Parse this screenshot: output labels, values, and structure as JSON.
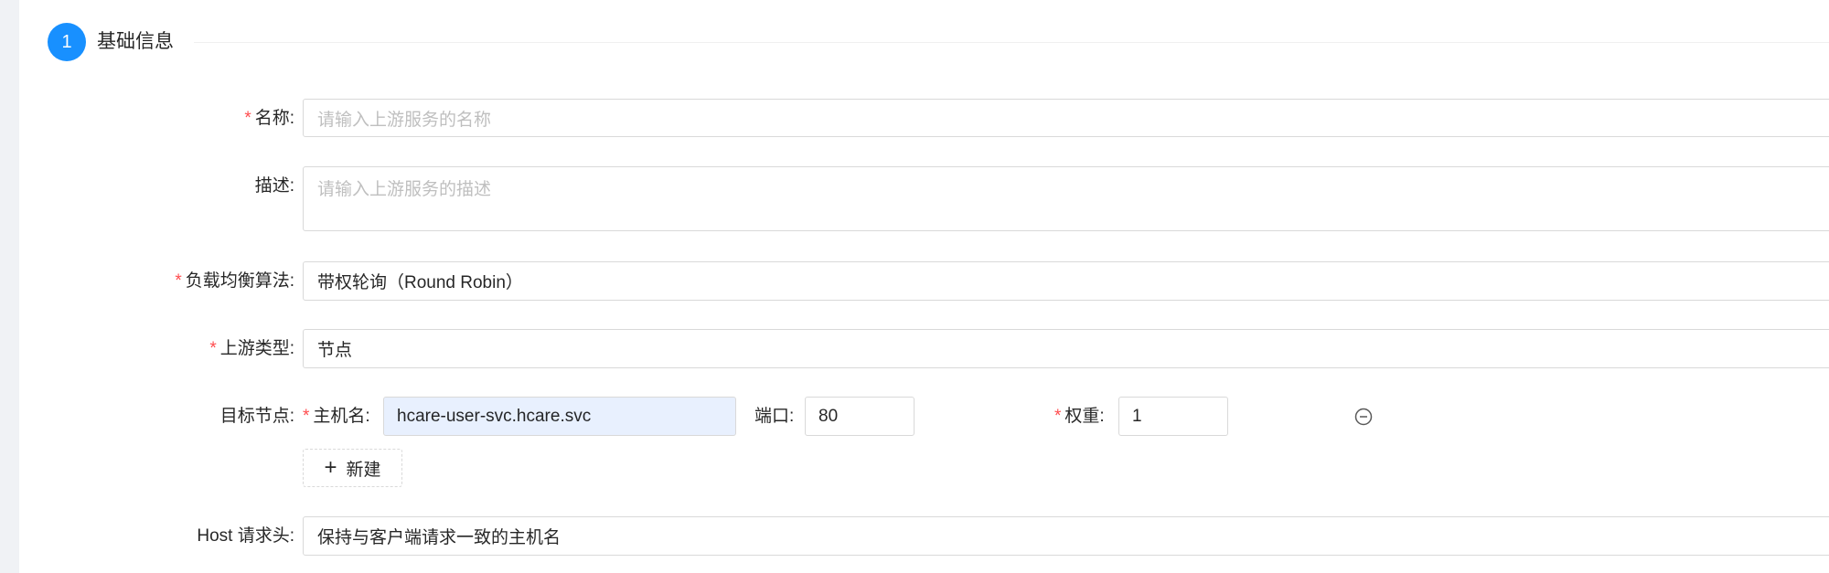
{
  "step": {
    "number": "1",
    "title": "基础信息"
  },
  "form": {
    "name": {
      "label": "名称:",
      "required": true,
      "placeholder": "请输入上游服务的名称"
    },
    "description": {
      "label": "描述:",
      "required": false,
      "placeholder": "请输入上游服务的描述"
    },
    "algorithm": {
      "label": "负载均衡算法:",
      "required": true,
      "value": "带权轮询（Round Robin）"
    },
    "upstream_type": {
      "label": "上游类型:",
      "required": true,
      "value": "节点"
    },
    "target_nodes": {
      "label": "目标节点:",
      "hostname_label": "主机名:",
      "hostname_value": "hcare-user-svc.hcare.svc",
      "port_label": "端口:",
      "port_value": "80",
      "weight_label": "权重:",
      "weight_value": "1",
      "add_button_label": "新建"
    },
    "host_header": {
      "label": "Host 请求头:",
      "value": "保持与客户端请求一致的主机名"
    }
  },
  "colors": {
    "primary": "#1890ff",
    "required": "#ff4d4f",
    "autofill": "#e8f0fe"
  }
}
